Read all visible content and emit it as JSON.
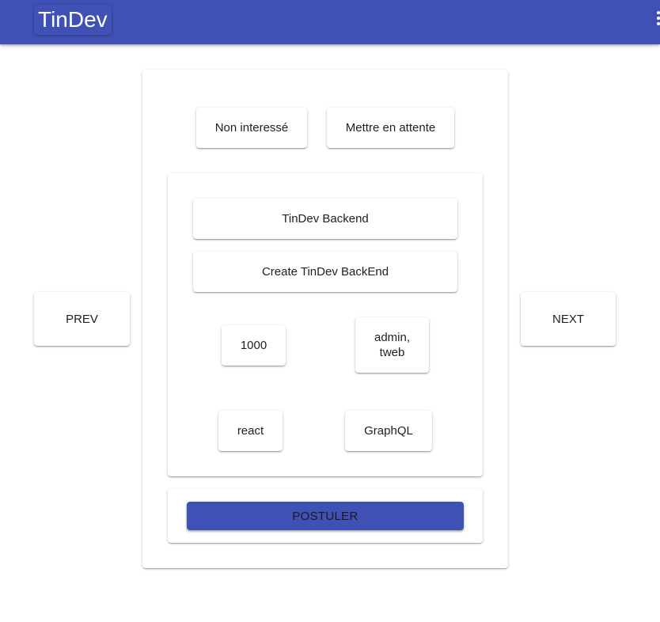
{
  "app": {
    "title": "TinDev",
    "brand_color": "#3f51b5"
  },
  "header": {
    "menu_icon": "more-vert-icon"
  },
  "actions": {
    "reject_label": "Non interessé",
    "hold_label": "Mettre en attente"
  },
  "navigation": {
    "prev_label": "PREV",
    "next_label": "NEXT"
  },
  "project": {
    "name": "TinDev Backend",
    "description": "Create TinDev BackEnd",
    "budget": "1000",
    "owners_line1": "admin,",
    "owners_line2": "tweb",
    "technologies": [
      "react",
      "GraphQL"
    ]
  },
  "apply": {
    "label": "POSTULER"
  }
}
